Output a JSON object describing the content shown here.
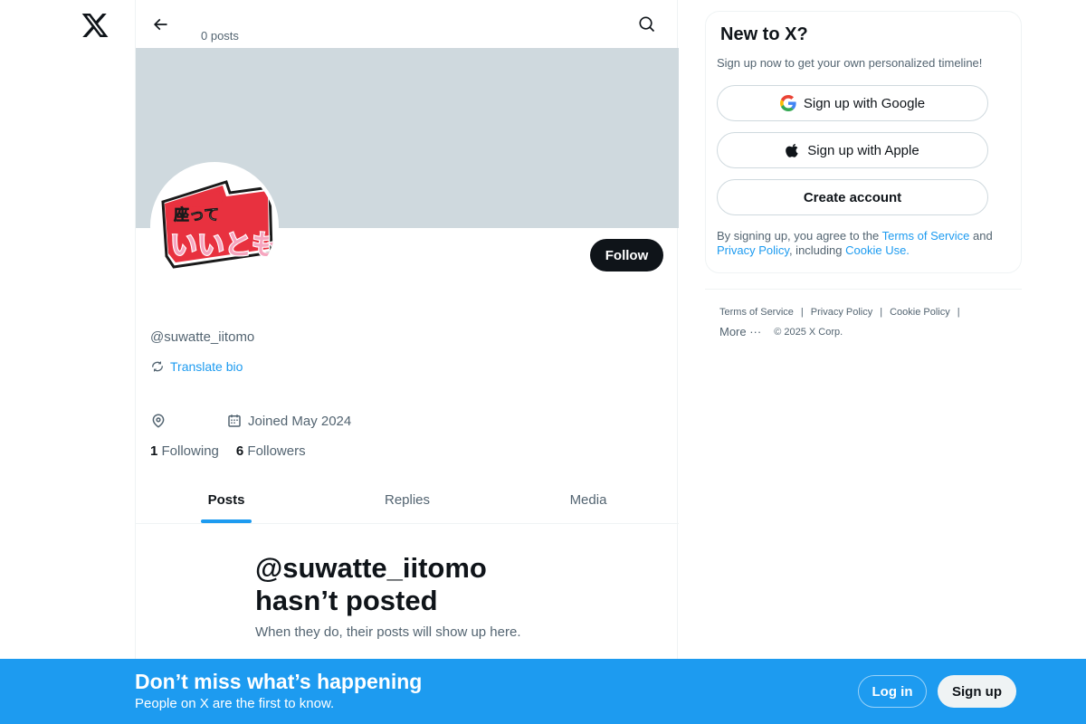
{
  "nav": {
    "logo_icon": "x-logo-icon"
  },
  "topbar": {
    "posts_count": "0 posts"
  },
  "profile": {
    "handle": "@suwatte_iitomo",
    "translate_label": "Translate bio",
    "joined": "Joined May 2024",
    "following_count": "1",
    "following_label": "Following",
    "followers_count": "6",
    "followers_label": "Followers",
    "follow_label": "Follow",
    "avatar_text_top": "座って",
    "avatar_text_main": "いいとも"
  },
  "tabs": [
    {
      "label": "Posts",
      "active": true
    },
    {
      "label": "Replies",
      "active": false
    },
    {
      "label": "Media",
      "active": false
    }
  ],
  "empty_state": {
    "title_line1": "@suwatte_iitomo",
    "title_line2": "hasn’t posted",
    "subtitle": "When they do, their posts will show up here."
  },
  "signup": {
    "title": "New to X?",
    "description": "Sign up now to get your own personalized timeline!",
    "google_label": "Sign up with Google",
    "apple_label": "Sign up with Apple",
    "create_label": "Create account",
    "legal_prefix": "By signing up, you agree to the ",
    "terms_link": "Terms of Service",
    "legal_and": " and ",
    "privacy_link": "Privacy Policy",
    "legal_including": ", including ",
    "cookie_link": "Cookie Use."
  },
  "footer": {
    "terms": "Terms of Service",
    "privacy": "Privacy Policy",
    "cookie": "Cookie Policy",
    "more": "More ···",
    "copyright": "© 2025 X Corp."
  },
  "bottom_bar": {
    "title": "Don’t miss what’s happening",
    "subtitle": "People on X are the first to know.",
    "login_label": "Log in",
    "signup_label": "Sign up"
  },
  "colors": {
    "accent": "#1d9bf0",
    "banner": "#cfd9de",
    "text_primary": "#0f1419",
    "text_secondary": "#536471"
  }
}
